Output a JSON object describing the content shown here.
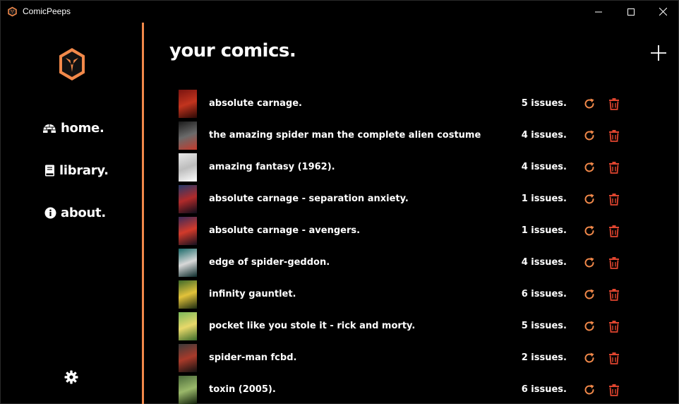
{
  "window": {
    "title": "ComicPeeps"
  },
  "sidebar": {
    "nav": [
      {
        "label": "home.",
        "icon": "igloo-icon"
      },
      {
        "label": "library.",
        "icon": "book-icon"
      },
      {
        "label": "about.",
        "icon": "info-icon"
      }
    ]
  },
  "main": {
    "title": "your comics."
  },
  "colors": {
    "accent": "#f2894a",
    "danger": "#e0452f",
    "background": "#000000"
  },
  "comics": [
    {
      "title": "absolute carnage.",
      "issues": "5 issues.",
      "cover": [
        "#7a1410",
        "#c2341e",
        "#2a0805"
      ]
    },
    {
      "title": "the amazing spider man the complete alien costume",
      "issues": "4 issues.",
      "cover": [
        "#1b1b1b",
        "#6a6a6a",
        "#c43a2c"
      ]
    },
    {
      "title": "amazing fantasy (1962).",
      "issues": "4 issues.",
      "cover": [
        "#e8e8e8",
        "#bdbdbd",
        "#ffffff"
      ]
    },
    {
      "title": "absolute carnage - separation anxiety.",
      "issues": "1 issues.",
      "cover": [
        "#243a6b",
        "#b02a2a",
        "#0c0c1a"
      ]
    },
    {
      "title": "absolute carnage - avengers.",
      "issues": "1 issues.",
      "cover": [
        "#3b2a5a",
        "#d23a2a",
        "#141020"
      ]
    },
    {
      "title": "edge of spider-geddon.",
      "issues": "4 issues.",
      "cover": [
        "#1a6a6a",
        "#d8d8d8",
        "#0a2a2a"
      ]
    },
    {
      "title": "infinity gauntlet.",
      "issues": "6 issues.",
      "cover": [
        "#3e6a2a",
        "#e2c23a",
        "#1a2a10"
      ]
    },
    {
      "title": "pocket like you stole it - rick and morty.",
      "issues": "5 issues.",
      "cover": [
        "#7ab85a",
        "#e8d86a",
        "#3a6a2a"
      ]
    },
    {
      "title": "spider-man fcbd.",
      "issues": "2 issues.",
      "cover": [
        "#3a3a3a",
        "#a83a2a",
        "#101010"
      ]
    },
    {
      "title": "toxin (2005).",
      "issues": "6 issues.",
      "cover": [
        "#4a6a3a",
        "#9ab86a",
        "#10200a"
      ]
    }
  ]
}
